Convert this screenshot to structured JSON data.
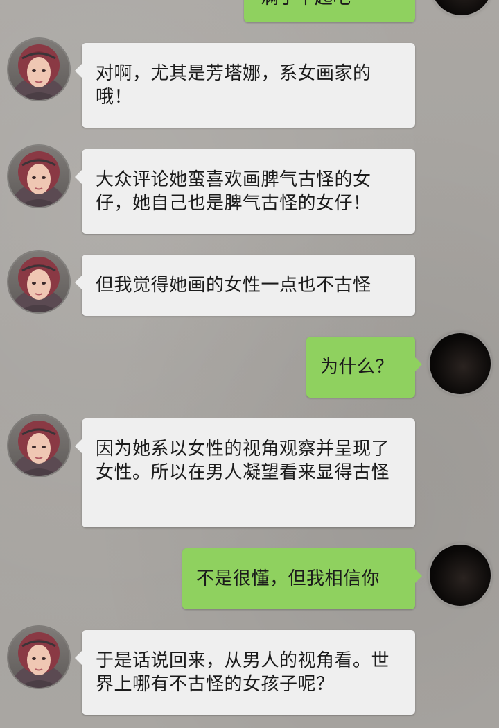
{
  "chat": {
    "partial_top_message": "满了不起吧",
    "messages": [
      {
        "side": "in",
        "text": "对啊，尤其是芳塔娜，系女画家的哦！"
      },
      {
        "side": "in",
        "text": "大众评论她蛮喜欢画脾气古怪的女仔，她自己也是脾气古怪的女仔！"
      },
      {
        "side": "in",
        "text": "但我觉得她画的女性一点也不古怪"
      },
      {
        "side": "out",
        "text": "为什么？"
      },
      {
        "side": "in",
        "text": "因为她系以女性的视角观察并呈现了女性。所以在男人凝望看来显得古怪"
      },
      {
        "side": "out",
        "text": "不是很懂，但我相信你"
      },
      {
        "side": "in",
        "text": "于是话说回来，从男人的视角看。世界上哪有不古怪的女孩子呢？"
      }
    ]
  },
  "colors": {
    "background": "#a8a5a1",
    "incoming_bubble": "#efefef",
    "outgoing_bubble": "#8fd15f",
    "text": "#1b1b1b"
  },
  "icons": {
    "contact_avatar": "girl-portrait-avatar",
    "self_avatar": "dark-circle-avatar"
  }
}
